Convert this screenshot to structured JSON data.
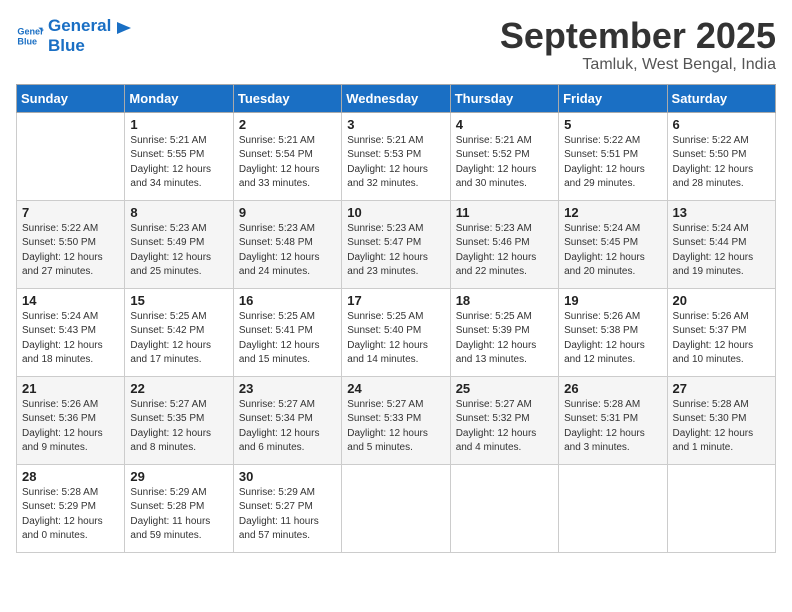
{
  "header": {
    "logo_line1": "General",
    "logo_line2": "Blue",
    "month": "September 2025",
    "location": "Tamluk, West Bengal, India"
  },
  "days_of_week": [
    "Sunday",
    "Monday",
    "Tuesday",
    "Wednesday",
    "Thursday",
    "Friday",
    "Saturday"
  ],
  "weeks": [
    [
      {
        "day": "",
        "sunrise": "",
        "sunset": "",
        "daylight": ""
      },
      {
        "day": "1",
        "sunrise": "5:21 AM",
        "sunset": "5:55 PM",
        "daylight": "12 hours and 34 minutes."
      },
      {
        "day": "2",
        "sunrise": "5:21 AM",
        "sunset": "5:54 PM",
        "daylight": "12 hours and 33 minutes."
      },
      {
        "day": "3",
        "sunrise": "5:21 AM",
        "sunset": "5:53 PM",
        "daylight": "12 hours and 32 minutes."
      },
      {
        "day": "4",
        "sunrise": "5:21 AM",
        "sunset": "5:52 PM",
        "daylight": "12 hours and 30 minutes."
      },
      {
        "day": "5",
        "sunrise": "5:22 AM",
        "sunset": "5:51 PM",
        "daylight": "12 hours and 29 minutes."
      },
      {
        "day": "6",
        "sunrise": "5:22 AM",
        "sunset": "5:50 PM",
        "daylight": "12 hours and 28 minutes."
      }
    ],
    [
      {
        "day": "7",
        "sunrise": "5:22 AM",
        "sunset": "5:50 PM",
        "daylight": "12 hours and 27 minutes."
      },
      {
        "day": "8",
        "sunrise": "5:23 AM",
        "sunset": "5:49 PM",
        "daylight": "12 hours and 25 minutes."
      },
      {
        "day": "9",
        "sunrise": "5:23 AM",
        "sunset": "5:48 PM",
        "daylight": "12 hours and 24 minutes."
      },
      {
        "day": "10",
        "sunrise": "5:23 AM",
        "sunset": "5:47 PM",
        "daylight": "12 hours and 23 minutes."
      },
      {
        "day": "11",
        "sunrise": "5:23 AM",
        "sunset": "5:46 PM",
        "daylight": "12 hours and 22 minutes."
      },
      {
        "day": "12",
        "sunrise": "5:24 AM",
        "sunset": "5:45 PM",
        "daylight": "12 hours and 20 minutes."
      },
      {
        "day": "13",
        "sunrise": "5:24 AM",
        "sunset": "5:44 PM",
        "daylight": "12 hours and 19 minutes."
      }
    ],
    [
      {
        "day": "14",
        "sunrise": "5:24 AM",
        "sunset": "5:43 PM",
        "daylight": "12 hours and 18 minutes."
      },
      {
        "day": "15",
        "sunrise": "5:25 AM",
        "sunset": "5:42 PM",
        "daylight": "12 hours and 17 minutes."
      },
      {
        "day": "16",
        "sunrise": "5:25 AM",
        "sunset": "5:41 PM",
        "daylight": "12 hours and 15 minutes."
      },
      {
        "day": "17",
        "sunrise": "5:25 AM",
        "sunset": "5:40 PM",
        "daylight": "12 hours and 14 minutes."
      },
      {
        "day": "18",
        "sunrise": "5:25 AM",
        "sunset": "5:39 PM",
        "daylight": "12 hours and 13 minutes."
      },
      {
        "day": "19",
        "sunrise": "5:26 AM",
        "sunset": "5:38 PM",
        "daylight": "12 hours and 12 minutes."
      },
      {
        "day": "20",
        "sunrise": "5:26 AM",
        "sunset": "5:37 PM",
        "daylight": "12 hours and 10 minutes."
      }
    ],
    [
      {
        "day": "21",
        "sunrise": "5:26 AM",
        "sunset": "5:36 PM",
        "daylight": "12 hours and 9 minutes."
      },
      {
        "day": "22",
        "sunrise": "5:27 AM",
        "sunset": "5:35 PM",
        "daylight": "12 hours and 8 minutes."
      },
      {
        "day": "23",
        "sunrise": "5:27 AM",
        "sunset": "5:34 PM",
        "daylight": "12 hours and 6 minutes."
      },
      {
        "day": "24",
        "sunrise": "5:27 AM",
        "sunset": "5:33 PM",
        "daylight": "12 hours and 5 minutes."
      },
      {
        "day": "25",
        "sunrise": "5:27 AM",
        "sunset": "5:32 PM",
        "daylight": "12 hours and 4 minutes."
      },
      {
        "day": "26",
        "sunrise": "5:28 AM",
        "sunset": "5:31 PM",
        "daylight": "12 hours and 3 minutes."
      },
      {
        "day": "27",
        "sunrise": "5:28 AM",
        "sunset": "5:30 PM",
        "daylight": "12 hours and 1 minute."
      }
    ],
    [
      {
        "day": "28",
        "sunrise": "5:28 AM",
        "sunset": "5:29 PM",
        "daylight": "12 hours and 0 minutes."
      },
      {
        "day": "29",
        "sunrise": "5:29 AM",
        "sunset": "5:28 PM",
        "daylight": "11 hours and 59 minutes."
      },
      {
        "day": "30",
        "sunrise": "5:29 AM",
        "sunset": "5:27 PM",
        "daylight": "11 hours and 57 minutes."
      },
      {
        "day": "",
        "sunrise": "",
        "sunset": "",
        "daylight": ""
      },
      {
        "day": "",
        "sunrise": "",
        "sunset": "",
        "daylight": ""
      },
      {
        "day": "",
        "sunrise": "",
        "sunset": "",
        "daylight": ""
      },
      {
        "day": "",
        "sunrise": "",
        "sunset": "",
        "daylight": ""
      }
    ]
  ]
}
